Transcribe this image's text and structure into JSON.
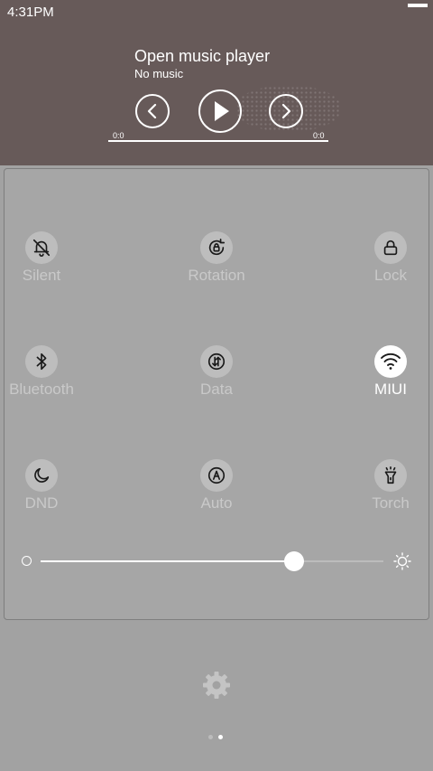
{
  "status_bar": {
    "time": "4:31PM"
  },
  "music": {
    "title": "Open music player",
    "subtitle": "No music",
    "elapsed": "0:0",
    "duration": "0:0",
    "icons": {
      "previous": "chevron-left-icon",
      "play": "play-icon",
      "next": "chevron-right-icon"
    }
  },
  "toggles": [
    {
      "label": "Silent",
      "icon": "bell-off-icon",
      "active": false
    },
    {
      "label": "Rotation",
      "icon": "rotation-lock-icon",
      "active": false
    },
    {
      "label": "Lock",
      "icon": "lock-icon",
      "active": false
    },
    {
      "label": "Bluetooth",
      "icon": "bluetooth-icon",
      "active": false
    },
    {
      "label": "Data",
      "icon": "mobile-data-icon",
      "active": false
    },
    {
      "label": "MIUI",
      "icon": "wifi-icon",
      "active": true
    },
    {
      "label": "DND",
      "icon": "moon-icon",
      "active": false
    },
    {
      "label": "Auto",
      "icon": "auto-brightness-icon",
      "active": false
    },
    {
      "label": "Torch",
      "icon": "flashlight-icon",
      "active": false
    }
  ],
  "brightness": {
    "level": 0.74
  },
  "pager": {
    "pages": 2,
    "current": 2
  },
  "colors": {
    "music_background": "#675a59",
    "panel_background": "#a6a6a6",
    "active_tile": "#ffffff",
    "inactive_tile": "#bdbdbd"
  }
}
